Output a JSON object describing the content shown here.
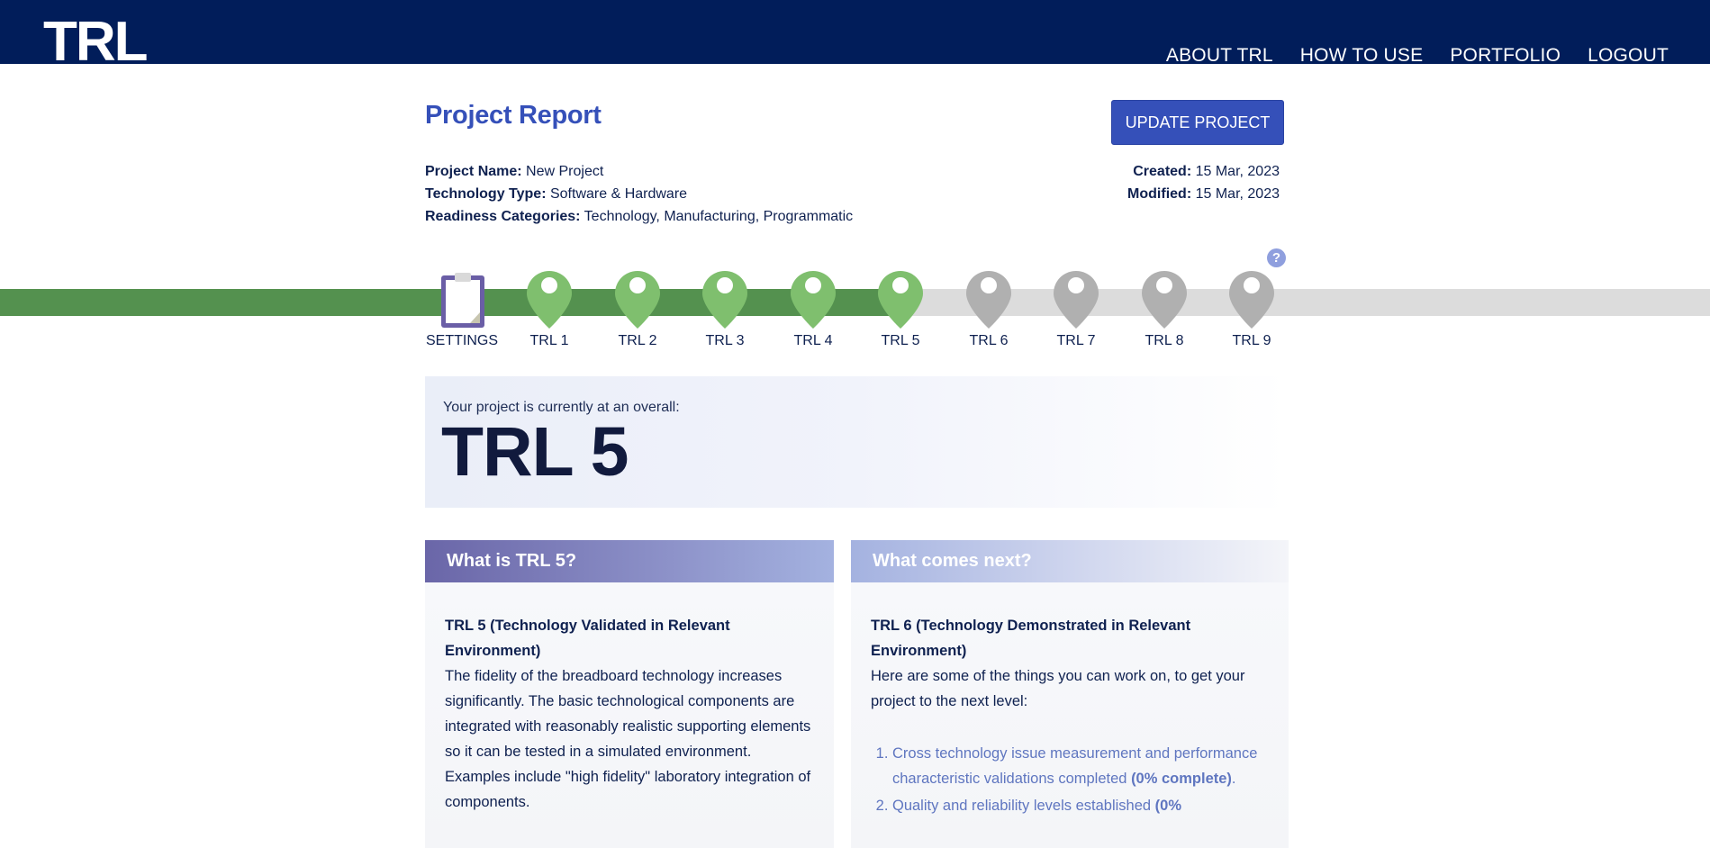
{
  "header": {
    "logo": "TRL",
    "nav": [
      "ABOUT TRL",
      "HOW TO USE",
      "PORTFOLIO",
      "LOGOUT"
    ]
  },
  "report": {
    "title": "Project Report",
    "update_label": "UPDATE PROJECT",
    "project_name_label": "Project Name:",
    "project_name": "New Project",
    "tech_type_label": "Technology Type:",
    "tech_type": "Software & Hardware",
    "categories_label": "Readiness Categories:",
    "categories": "Technology, Manufacturing, Programmatic",
    "created_label": "Created:",
    "created": "15 Mar, 2023",
    "modified_label": "Modified:",
    "modified": "15 Mar, 2023"
  },
  "progress": {
    "help_glyph": "?",
    "settings_label": "SETTINGS",
    "current_level": 5,
    "steps": [
      "TRL 1",
      "TRL 2",
      "TRL 3",
      "TRL 4",
      "TRL 5",
      "TRL 6",
      "TRL 7",
      "TRL 8",
      "TRL 9"
    ],
    "colors": {
      "complete": "#7fbf6e",
      "incomplete": "#b0b0b0",
      "track_done": "#54914f",
      "track_todo": "#dcdcdc"
    }
  },
  "status": {
    "intro": "Your project is currently at an overall:",
    "level": "TRL 5"
  },
  "current_card": {
    "header": "What is TRL 5?",
    "heading": "TRL 5 (Technology Validated in Relevant Environment)",
    "text": "The fidelity of the breadboard technology increases significantly. The basic technological components are integrated with reasonably realistic supporting elements so it can be tested in a simulated environment. Examples include \"high fidelity\" laboratory integration of components."
  },
  "next_card": {
    "header": "What comes next?",
    "heading": "TRL 6 (Technology Demonstrated in Relevant Environment)",
    "intro": "Here are some of the things you can work on, to get your project to the next level:",
    "items": [
      {
        "text": "Cross technology issue measurement and performance characteristic validations completed",
        "pct": "(0% complete)",
        "tail": "."
      },
      {
        "text": "Quality and reliability levels established",
        "pct": "(0%",
        "tail": ""
      }
    ]
  }
}
